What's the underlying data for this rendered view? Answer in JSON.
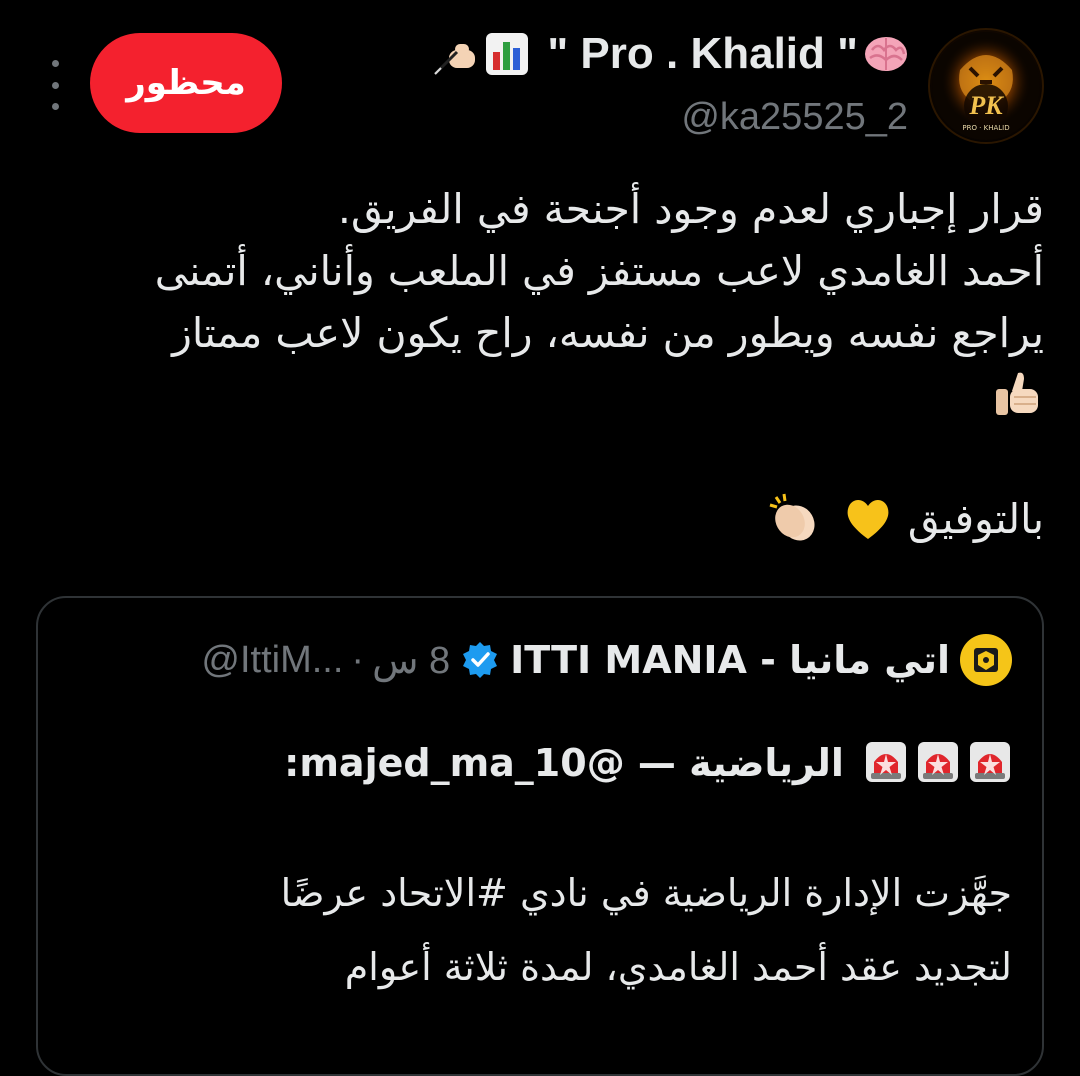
{
  "author": {
    "display_name_prefix_emoji": [
      "writing-hand-icon",
      "bar-chart-icon"
    ],
    "display_name": " \" Pro . Khalid \"",
    "display_name_suffix_emoji": [
      "brain-icon"
    ],
    "handle": "@ka25525_2",
    "avatar": "pro-khalid-tiger-logo",
    "avatar_logo_text": "PK",
    "avatar_logo_subtext": "PRO · KHALID"
  },
  "actions": {
    "blocked_label": "محظور",
    "more_icon": "more-vertical-icon"
  },
  "tweet": {
    "lines": [
      "قرار إجباري لعدم وجود أجنحة في الفريق.",
      "أحمد الغامدي لاعب مستفز في الملعب وأناني، أتمنى",
      "يراجع نفسه ويطور من نفسه، راح يكون لاعب ممتاز"
    ],
    "line4_emoji": "thumbs-up-icon",
    "closing_text": "بالتوفيق",
    "closing_emoji": [
      "yellow-heart-icon",
      "clapping-hands-icon"
    ]
  },
  "quoted_tweet": {
    "author_name": "اتي مانيا - ITTI MANIA",
    "verified": true,
    "handle": "@IttiM...",
    "separator": "·",
    "time": "8 س",
    "avatar": "itti-mania-logo",
    "header_line_emoji": [
      "siren-icon",
      "siren-icon",
      "siren-icon"
    ],
    "header_line_text": "الرياضية — @majed_ma_10:",
    "body_lines": [
      "جهَّزت الإدارة الرياضية في نادي #الاتحاد عرضًا",
      "لتجديد عقد أحمد الغامدي، لمدة ثلاثة أعوام"
    ]
  },
  "colors": {
    "background": "#000000",
    "text_primary": "#e7e9ea",
    "text_secondary": "#71767b",
    "blocked_button": "#f4212e",
    "card_border": "#2f3336",
    "verified_blue": "#1d9bf0"
  }
}
